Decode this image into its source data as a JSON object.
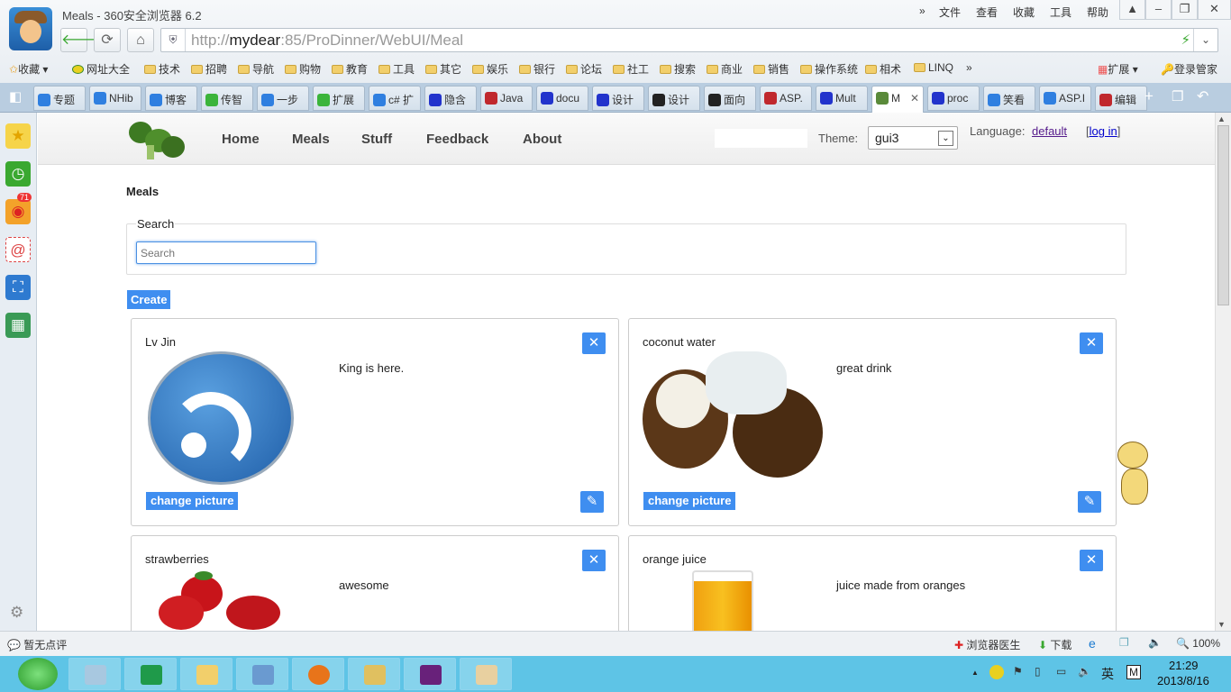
{
  "window": {
    "title": "Meals - 360安全浏览器 6.2",
    "menu": [
      "»",
      "文件",
      "查看",
      "收藏",
      "工具",
      "帮助"
    ],
    "controls": [
      "shirt",
      "minimize",
      "restore",
      "close"
    ]
  },
  "address": {
    "scheme": "http://",
    "host": "mydear",
    "rest": ":85/ProDinner/WebUI/Meal"
  },
  "bookmarks": {
    "favorites": "收藏",
    "items": [
      "网址大全",
      "技术",
      "招聘",
      "导航",
      "购物",
      "教育",
      "工具",
      "其它",
      "娱乐",
      "银行",
      "论坛",
      "社工",
      "搜索",
      "商业",
      "销售",
      "操作系统",
      "相术",
      "LINQ"
    ],
    "more": "»",
    "extensions": "扩展",
    "login_manager": "登录管家"
  },
  "tabs": [
    {
      "label": "专题",
      "c": "#2f7fe0"
    },
    {
      "label": "NHib",
      "c": "#2f7fe0"
    },
    {
      "label": "博客",
      "c": "#2f7fe0"
    },
    {
      "label": "传智",
      "c": "#3bb43b"
    },
    {
      "label": "一步",
      "c": "#2f7fe0"
    },
    {
      "label": "扩展",
      "c": "#3bb43b"
    },
    {
      "label": "c# 扩",
      "c": "#2f7fe0"
    },
    {
      "label": "隐含",
      "c": "#2233cc"
    },
    {
      "label": "Java",
      "c": "#c0282d"
    },
    {
      "label": "docu",
      "c": "#2233cc"
    },
    {
      "label": "设计",
      "c": "#2233cc"
    },
    {
      "label": "设计",
      "c": "#222"
    },
    {
      "label": "面向",
      "c": "#222"
    },
    {
      "label": "ASP.",
      "c": "#c0282d"
    },
    {
      "label": "Mult",
      "c": "#2233cc"
    },
    {
      "label": "M",
      "c": "#5a8a3a"
    },
    {
      "label": "proc",
      "c": "#2233cc"
    },
    {
      "label": "笑看",
      "c": "#2f7fe0"
    },
    {
      "label": "ASP.I",
      "c": "#2f7fe0"
    },
    {
      "label": "编辑",
      "c": "#c0282d"
    }
  ],
  "sidebar": {
    "weibo_badge": "71"
  },
  "site": {
    "nav": [
      "Home",
      "Meals",
      "Stuff",
      "Feedback",
      "About"
    ],
    "theme_label": "Theme:",
    "theme_value": "gui3",
    "language_label": "Language:",
    "language_value": "default",
    "login": "log in",
    "bracket_open": "[",
    "bracket_close": "]"
  },
  "main": {
    "heading": "Meals",
    "search_legend": "Search",
    "search_placeholder": "Search",
    "create": "Create",
    "change_picture": "change picture",
    "meals": [
      {
        "name": "Lv Jin",
        "desc": "King is here."
      },
      {
        "name": "coconut water",
        "desc": "great drink"
      },
      {
        "name": "strawberries",
        "desc": "awesome"
      },
      {
        "name": "orange juice",
        "desc": "juice made from oranges"
      }
    ]
  },
  "status": {
    "comment": "暂无点评",
    "doctor": "浏览器医生",
    "download": "下载",
    "zoom": "100%"
  },
  "taskbar": {
    "time": "21:29",
    "date": "2013/8/16",
    "ime": "英"
  }
}
